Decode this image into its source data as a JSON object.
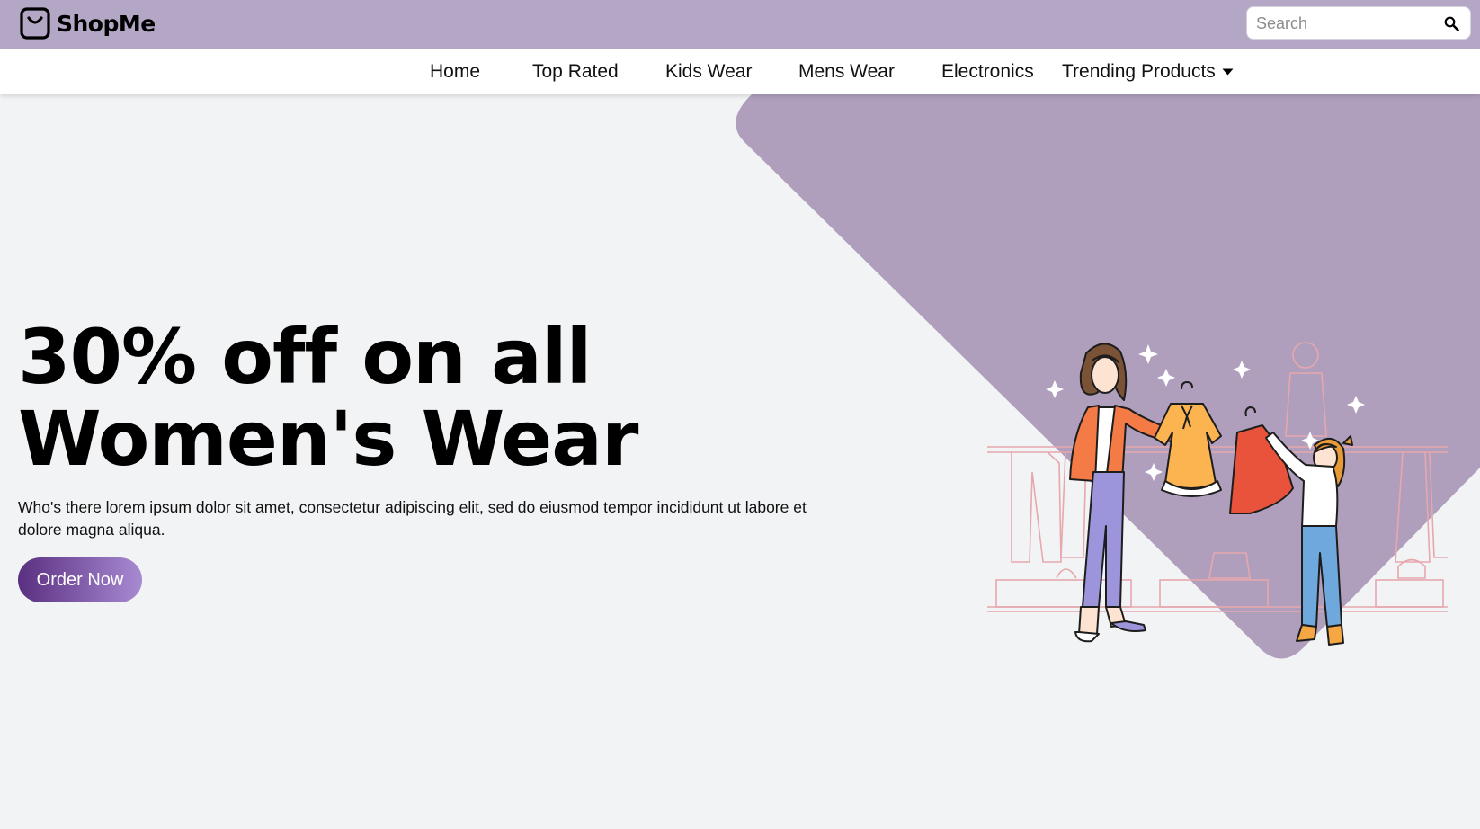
{
  "brand": {
    "name": "ShopMe",
    "icon": "shopping-bag-icon"
  },
  "search": {
    "placeholder": "Search",
    "value": "",
    "icon": "search-icon"
  },
  "nav": {
    "items": [
      {
        "label": "Home"
      },
      {
        "label": "Top Rated"
      },
      {
        "label": "Kids Wear"
      },
      {
        "label": "Mens Wear"
      },
      {
        "label": "Electronics"
      },
      {
        "label": "Trending Products",
        "icon": "caret-down-icon"
      }
    ]
  },
  "hero": {
    "headline_line1": "30% off on all",
    "headline_line2": "Women's Wear",
    "description": "Who's there lorem ipsum dolor sit amet, consectetur adipiscing elit, sed do eiusmod tempor incididunt ut labore et dolore magna aliqua.",
    "cta_label": "Order Now",
    "illustration": "mother-and-daughter-shopping-illustration"
  },
  "colors": {
    "topbar": "#b4a7c5",
    "hero_shape": "#af9fbd",
    "page_background": "#f2f3f5",
    "button_gradient_start": "#5a2f80",
    "button_gradient_end": "#a88ad2"
  }
}
